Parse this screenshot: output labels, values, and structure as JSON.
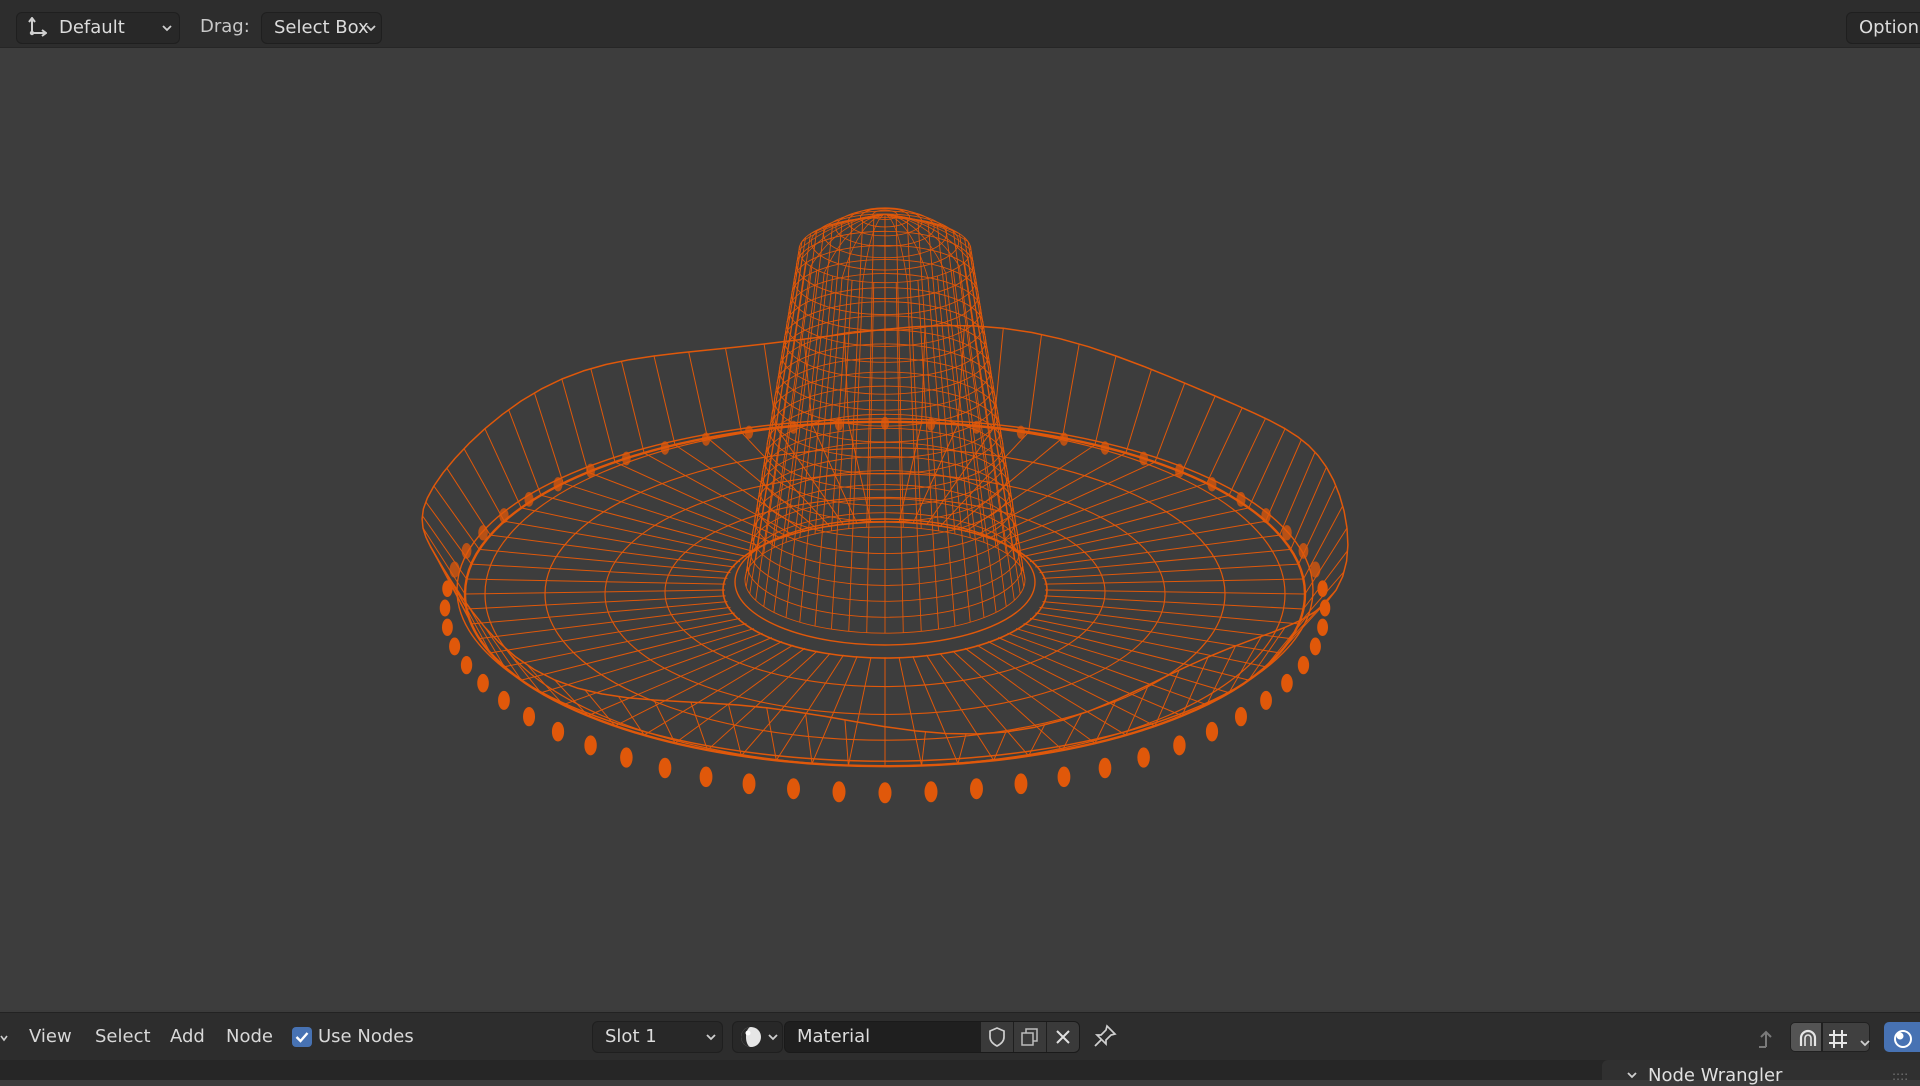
{
  "top_header": {
    "mode_dropdown": {
      "value": "Default",
      "icon": "transform-orientation-icon"
    },
    "drag_label": "Drag:",
    "drag_dropdown": {
      "value": "Select Box"
    },
    "options_label": "Options"
  },
  "viewport": {
    "object": "wireframe-sombrero",
    "wire_color": "#e0580a",
    "background_color": "#3d3d3d"
  },
  "bottom_header": {
    "menus": [
      "View",
      "Select",
      "Add",
      "Node"
    ],
    "use_nodes": {
      "label": "Use Nodes",
      "checked": true
    },
    "slot_dropdown": {
      "value": "Slot 1"
    },
    "material_field": {
      "value": "Material"
    },
    "icons": [
      "shield-icon",
      "duplicate-icon",
      "close-icon",
      "pin-icon",
      "parent-arrow-icon",
      "snap-magnet-icon",
      "snap-grid-icon",
      "overlay-icon"
    ]
  },
  "side_panel_tab": {
    "label": "Node Wrangler"
  },
  "colors": {
    "accent": "#4772b3",
    "header_bg": "#2d2d2d",
    "wire": "#e0580a"
  }
}
